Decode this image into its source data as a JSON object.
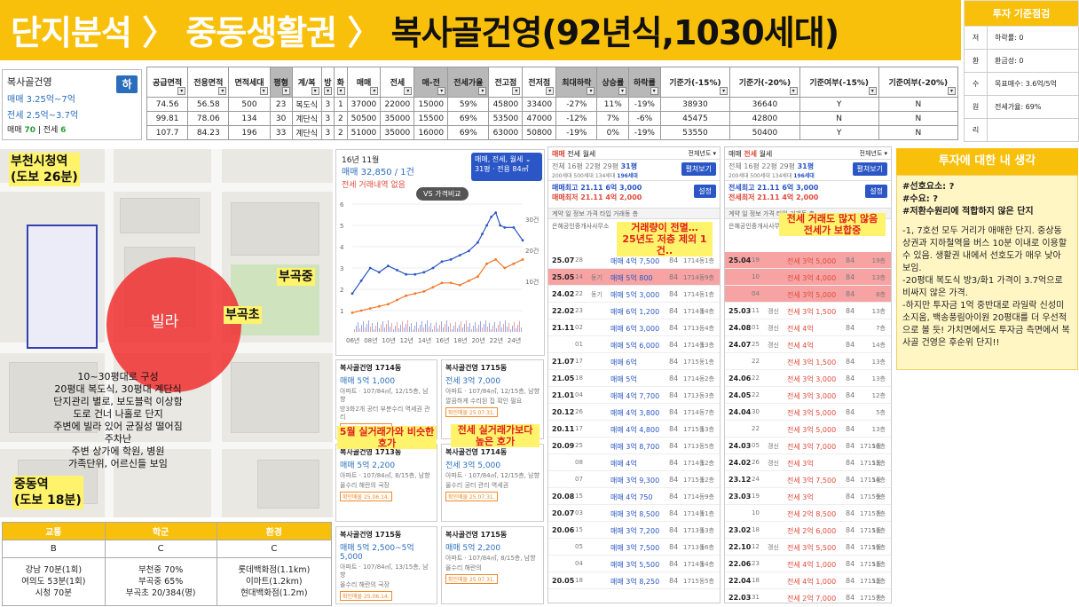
{
  "header": {
    "part1": "단지분석",
    "sep1": "〉",
    "part2": "중동생활권",
    "sep2": "〉",
    "part3": "복사골건영(92년식,1030세대)"
  },
  "criteria": {
    "title": "투자 기준점검",
    "rows": [
      {
        "k": "저",
        "v": "하락률: 0"
      },
      {
        "k": "환",
        "v": "환금성: 0"
      },
      {
        "k": "수",
        "v": "목표매수: 3.6억/5억"
      },
      {
        "k": "원",
        "v": "전세가율: 69%"
      },
      {
        "k": "리",
        "v": ""
      }
    ]
  },
  "complex": {
    "name": "복사골건영",
    "floor_badge": "하",
    "sale_range": "매매 3.25억~7억",
    "jeonse_range": "전세 2.5억~3.7억",
    "sale_label": "매매",
    "sale_count": "70",
    "jeonse_label": "전세",
    "jeonse_count": "6"
  },
  "table": {
    "headers": [
      "공급면적",
      "전용면적",
      "면적세대",
      "평형",
      "계/복",
      "방",
      "화",
      "매매",
      "전세",
      "매-전",
      "전세가율",
      "전고점",
      "전저점",
      "최대하락",
      "상승률",
      "하락률",
      "기준가(-15%)",
      "기준가(-20%)",
      "기준여부(-15%)",
      "기준여부(-20%)"
    ],
    "rows": [
      [
        "74.56",
        "56.58",
        "500",
        "23",
        "복도식",
        "3",
        "1",
        "37000",
        "22000",
        "15000",
        "59%",
        "45800",
        "33400",
        "-27%",
        "11%",
        "-19%",
        "38930",
        "36640",
        "Y",
        "N"
      ],
      [
        "99.81",
        "78.06",
        "134",
        "30",
        "계단식",
        "3",
        "2",
        "50500",
        "35000",
        "15500",
        "69%",
        "53500",
        "47000",
        "-12%",
        "7%",
        "-6%",
        "45475",
        "42800",
        "N",
        "N"
      ],
      [
        "107.7",
        "84.23",
        "196",
        "33",
        "계단식",
        "3",
        "2",
        "51000",
        "35000",
        "16000",
        "69%",
        "63000",
        "50800",
        "-19%",
        "0%",
        "-19%",
        "53550",
        "50400",
        "Y",
        "N"
      ]
    ]
  },
  "map": {
    "station_top": "부천시청역",
    "station_top_walk": "(도보 26분)",
    "school_mid": "부곡중",
    "school_elem": "부곡초",
    "villa": "빌라",
    "station_bottom": "중동역",
    "station_bottom_walk": "(도보 18분)",
    "notes": [
      "10~30평대로 구성",
      "20평대 복도식, 30평대 계단식",
      "단지관리 별로, 보도블럭 이상함",
      "도로 건너 나홀로 단지",
      "주변에 빌라 있어 균질성 떨어짐",
      "주차난",
      "주변 상가에 학원, 병원",
      "가족단위, 어르신들 보임"
    ]
  },
  "scores": {
    "headers": [
      "교통",
      "학군",
      "환경"
    ],
    "grades": [
      "B",
      "C",
      "C"
    ],
    "details": [
      [
        "강남 70분(1회)",
        "여의도 53분(1회)",
        "시청 70분"
      ],
      [
        "부천중 70%",
        "부곡중 65%",
        "부곡초 20/384(명)"
      ],
      [
        "롯데백화점(1.1km)",
        "이마트(1.2km)",
        "현대백화점(1.2m)"
      ]
    ]
  },
  "chart_panel": {
    "date": "16년 11월",
    "price": "매매 32,850 / 1건",
    "no_deal": "전세 거래내역 없음",
    "type_line1": "매매, 전세, 월세 ⌄",
    "type_line2": "31평 · 전용 84㎡",
    "vs": "VS 가격비교",
    "x_ticks": [
      "06년",
      "08년",
      "10년",
      "12년",
      "14년",
      "16년",
      "18년",
      "20년",
      "22년",
      "24년"
    ],
    "y_left": [
      "6",
      "5",
      "4",
      "3",
      "2",
      "1"
    ],
    "y_right": [
      "30건",
      "20건",
      "10건"
    ]
  },
  "chart_data": {
    "type": "line",
    "title": "",
    "xlabel": "",
    "ylabel": "",
    "x_range": [
      2006,
      2025
    ],
    "ylim": [
      0,
      6
    ],
    "series": [
      {
        "name": "매매",
        "color": "#2a56c6",
        "x": [
          2006.0,
          2007.0,
          2008.0,
          2009.0,
          2010.0,
          2011.0,
          2012.0,
          2013.0,
          2014.0,
          2015.0,
          2016.0,
          2017.0,
          2018.0,
          2019.0,
          2020.0,
          2020.5,
          2021.0,
          2021.5,
          2022.0,
          2022.5,
          2023.0,
          2024.0,
          2025.0
        ],
        "y": [
          1.8,
          2.4,
          3.0,
          2.8,
          3.1,
          2.9,
          2.7,
          2.7,
          2.8,
          3.0,
          3.3,
          3.4,
          3.6,
          3.8,
          4.2,
          4.6,
          5.0,
          5.4,
          5.6,
          5.0,
          4.9,
          4.9,
          4.3
        ]
      },
      {
        "name": "전세",
        "color": "#f0792a",
        "x": [
          2006.0,
          2007.0,
          2008.0,
          2009.0,
          2010.0,
          2011.0,
          2012.0,
          2013.0,
          2014.0,
          2015.0,
          2016.0,
          2017.0,
          2018.0,
          2019.0,
          2020.0,
          2021.0,
          2022.0,
          2023.0,
          2024.0,
          2025.0
        ],
        "y": [
          0.9,
          1.0,
          1.1,
          1.2,
          1.3,
          1.5,
          1.7,
          1.8,
          1.9,
          2.1,
          2.3,
          2.3,
          2.2,
          2.4,
          2.6,
          3.2,
          3.4,
          3.0,
          3.2,
          3.4
        ]
      }
    ]
  },
  "listings": [
    {
      "title": "복사골건영 1714동",
      "price": "매매 5억 1,000",
      "d1": "아파트 · 107/84㎡, 12/15층, 남향",
      "d2": "방3화2개 공터 부분수리 역세권 관리",
      "tag": "확인매물 25.06.14."
    },
    {
      "title": "복사골건영 1715동",
      "price": "전세 3억 7,000",
      "d1": "아파트 · 107/84㎡, 12/15층, 남향",
      "d2": "깔끔하게 수리된 집 확인 필요",
      "tag": "확인매물 25.07.31."
    },
    {
      "title": "복사골건영 1713동",
      "price": "매매 5억 2,200",
      "d1": "아파트 · 107/84㎡, 8/15층, 남향",
      "d2": "올수리 해란의 국장",
      "tag": "확인매물 25.06.14."
    },
    {
      "title": "복사골건영 1714동",
      "price": "전세 3억 5,000",
      "d1": "아파트 · 107/84㎡, 12/15층, 남향",
      "d2": "올수리 공터 관리 역세권",
      "tag": "확인매물 25.07.31."
    },
    {
      "title": "복사골건영 1715동",
      "price": "매매 5억 2,500~5억 5,000",
      "d1": "아파트 · 107/84㎡, 13/15층, 남향",
      "d2": "올수리 해란의 국장",
      "tag": "확인매물 25.06.14."
    },
    {
      "title": "복사골건영 1715동",
      "price": "매매 5억 2,200",
      "d1": "아파트 · 107/84㎡, 8/15층, 남향",
      "d2": "올수리 해란의",
      "tag": "확인매물 25.07.31."
    }
  ],
  "notes": {
    "similar": "5월 실거래가와 비슷한 호가",
    "higher_line1": "전세 실거래가보다",
    "higher_line2": "높은 호가",
    "volume_line1": "거래량이 전멸…",
    "volume_line2": "25년도 저층 제외 1건..",
    "jeonse_line1": "전세 거래도 많지 않음",
    "jeonse_line2": "전세가 보합중"
  },
  "tx1": {
    "tab_sale": "매매",
    "tab_jeonse": "전세",
    "tab_rent": "월세",
    "year": "전체년도 ▾",
    "sizes": [
      "전체",
      "16평",
      "22평",
      "29평",
      "31평"
    ],
    "sub": [
      "",
      "200세대",
      "500세대",
      "134세대",
      "196세대"
    ],
    "btn_more": "펼쳐보기",
    "stat1": "매매최고 21.11 6억 3,000",
    "stat2": "매매최저 21.11 4억 2,000",
    "btn_set": "설정",
    "hdr": "계약    일    정보        가격        타입   거래동   층",
    "agent": "은혜공인중개사사무소",
    "rows": [
      {
        "d": "25.07",
        "dd": "28",
        "f": "",
        "p": "매매 4억 7,500",
        "a": "84",
        "u": "1714동",
        "fl": "1층",
        "pink": false
      },
      {
        "d": "25.05",
        "dd": "14",
        "f": "동기",
        "p": "매매 5억 800",
        "a": "84",
        "u": "1714동",
        "fl": "9층",
        "pink": true
      },
      {
        "d": "24.02",
        "dd": "22",
        "f": "동기",
        "p": "매매 5억 3,000",
        "a": "84",
        "u": "1714동",
        "fl": "1층",
        "pink": false
      },
      {
        "d": "22.02",
        "dd": "23",
        "f": "",
        "p": "매매 6억 1,200",
        "a": "84",
        "u": "1714동",
        "fl": "14층",
        "pink": false
      },
      {
        "d": "21.11",
        "dd": "02",
        "f": "",
        "p": "매매 6억 3,000",
        "a": "84",
        "u": "1713동",
        "fl": "4층",
        "pink": false
      },
      {
        "d": "",
        "dd": "01",
        "f": "",
        "p": "매매 5억 6,000",
        "a": "84",
        "u": "1714동",
        "fl": "13층",
        "pink": false
      },
      {
        "d": "21.07",
        "dd": "17",
        "f": "",
        "p": "매매 6억",
        "a": "84",
        "u": "1715동",
        "fl": "1층",
        "pink": false
      },
      {
        "d": "21.05",
        "dd": "18",
        "f": "",
        "p": "매매 5억",
        "a": "84",
        "u": "1714동",
        "fl": "2층",
        "pink": false
      },
      {
        "d": "21.01",
        "dd": "04",
        "f": "",
        "p": "매매 4억 7,700",
        "a": "84",
        "u": "1713동",
        "fl": "3층",
        "pink": false
      },
      {
        "d": "20.12",
        "dd": "26",
        "f": "",
        "p": "매매 4억 3,800",
        "a": "84",
        "u": "1714동",
        "fl": "7층",
        "pink": false
      },
      {
        "d": "20.11",
        "dd": "17",
        "f": "",
        "p": "매매 4억 4,800",
        "a": "84",
        "u": "1715동",
        "fl": "13층",
        "pink": false
      },
      {
        "d": "20.09",
        "dd": "25",
        "f": "",
        "p": "매매 3억 8,700",
        "a": "84",
        "u": "1713동",
        "fl": "5층",
        "pink": false
      },
      {
        "d": "",
        "dd": "08",
        "f": "",
        "p": "매매 4억",
        "a": "84",
        "u": "1714동",
        "fl": "12층",
        "pink": false
      },
      {
        "d": "",
        "dd": "07",
        "f": "",
        "p": "매매 3억 9,300",
        "a": "84",
        "u": "1715동",
        "fl": "12층",
        "pink": false
      },
      {
        "d": "20.08",
        "dd": "15",
        "f": "",
        "p": "매매 4억 750",
        "a": "84",
        "u": "1714동",
        "fl": "9층",
        "pink": false
      },
      {
        "d": "20.07",
        "dd": "03",
        "f": "",
        "p": "매매 3억 8,500",
        "a": "84",
        "u": "1714동",
        "fl": "11층",
        "pink": false
      },
      {
        "d": "20.06",
        "dd": "15",
        "f": "",
        "p": "매매 3억 7,200",
        "a": "84",
        "u": "1713동",
        "fl": "13층",
        "pink": false
      },
      {
        "d": "",
        "dd": "05",
        "f": "",
        "p": "매매 3억 7,500",
        "a": "84",
        "u": "1713동",
        "fl": "16층",
        "pink": false
      },
      {
        "d": "",
        "dd": "04",
        "f": "",
        "p": "매매 3억 5,500",
        "a": "84",
        "u": "1714동",
        "fl": "14층",
        "pink": false
      },
      {
        "d": "20.05",
        "dd": "18",
        "f": "",
        "p": "매매 3억 8,250",
        "a": "84",
        "u": "1715동",
        "fl": "5층",
        "pink": false
      }
    ]
  },
  "tx2": {
    "tab_sale": "매매",
    "tab_jeonse": "전세",
    "tab_rent": "월세",
    "year": "전체년도 ▾",
    "sizes": [
      "전체",
      "16평",
      "22평",
      "29평",
      "31평"
    ],
    "sub": [
      "",
      "200세대",
      "500세대",
      "134세대",
      "196세대"
    ],
    "btn_more": "펼쳐보기",
    "stat1": "전세최고 21.11 6억 3,000",
    "stat2": "전세최저 21.11 4억 2,000",
    "btn_set": "설정",
    "hdr": "계약    일    정보        가격        타입   거래동   층",
    "agent": "은혜공인중개사사무소",
    "rows": [
      {
        "d": "25.04",
        "dd": "19",
        "f": "",
        "p": "전세 3억 5,000",
        "a": "84",
        "u": "",
        "fl": "19층",
        "pink": true
      },
      {
        "d": "",
        "dd": "10",
        "f": "",
        "p": "전세 3억 4,000",
        "a": "84",
        "u": "",
        "fl": "13층",
        "pink": true
      },
      {
        "d": "",
        "dd": "04",
        "f": "",
        "p": "전세 3억 5,000",
        "a": "84",
        "u": "",
        "fl": "8층",
        "pink": true
      },
      {
        "d": "25.03",
        "dd": "11",
        "f": "갱신",
        "p": "전세 3억 1,500",
        "a": "84",
        "u": "",
        "fl": "13층",
        "pink": false
      },
      {
        "d": "24.08",
        "dd": "01",
        "f": "갱신",
        "p": "전세 4억",
        "a": "84",
        "u": "",
        "fl": "7층",
        "pink": false
      },
      {
        "d": "24.07",
        "dd": "25",
        "f": "갱신",
        "p": "전세 4억",
        "a": "84",
        "u": "",
        "fl": "14층",
        "pink": false
      },
      {
        "d": "",
        "dd": "22",
        "f": "",
        "p": "전세 3억 1,500",
        "a": "84",
        "u": "",
        "fl": "13층",
        "pink": false
      },
      {
        "d": "24.06",
        "dd": "22",
        "f": "",
        "p": "전세 3억 3,000",
        "a": "84",
        "u": "",
        "fl": "13층",
        "pink": false
      },
      {
        "d": "24.05",
        "dd": "22",
        "f": "",
        "p": "전세 3억 3,000",
        "a": "84",
        "u": "",
        "fl": "12층",
        "pink": false
      },
      {
        "d": "24.04",
        "dd": "30",
        "f": "",
        "p": "전세 3억 5,000",
        "a": "84",
        "u": "",
        "fl": "5층",
        "pink": false
      },
      {
        "d": "",
        "dd": "22",
        "f": "",
        "p": "전세 3억 5,000",
        "a": "84",
        "u": "",
        "fl": "13층",
        "pink": false
      },
      {
        "d": "24.03",
        "dd": "05",
        "f": "갱신",
        "p": "전세 3억 7,000",
        "a": "84",
        "u": "1715동",
        "fl": "10층",
        "pink": false
      },
      {
        "d": "24.02",
        "dd": "26",
        "f": "갱신",
        "p": "전세 3억",
        "a": "84",
        "u": "1715동",
        "fl": "13층",
        "pink": false
      },
      {
        "d": "23.12",
        "dd": "24",
        "f": "",
        "p": "전세 3억 7,500",
        "a": "84",
        "u": "1715동",
        "fl": "14층",
        "pink": false
      },
      {
        "d": "23.03",
        "dd": "19",
        "f": "",
        "p": "전세 3억",
        "a": "84",
        "u": "1715동",
        "fl": "9층",
        "pink": false
      },
      {
        "d": "",
        "dd": "10",
        "f": "",
        "p": "전세 2억 8,500",
        "a": "84",
        "u": "1715동",
        "fl": "7층",
        "pink": false
      },
      {
        "d": "23.02",
        "dd": "18",
        "f": "",
        "p": "전세 2억 6,000",
        "a": "84",
        "u": "1715동",
        "fl": "13층",
        "pink": false
      },
      {
        "d": "22.10",
        "dd": "12",
        "f": "갱신",
        "p": "전세 3억 5,500",
        "a": "84",
        "u": "1715동",
        "fl": "19층",
        "pink": false
      },
      {
        "d": "22.06",
        "dd": "23",
        "f": "",
        "p": "전세 4억 1,000",
        "a": "84",
        "u": "1715동",
        "fl": "13층",
        "pink": false
      },
      {
        "d": "22.04",
        "dd": "18",
        "f": "",
        "p": "전세 4억 1,000",
        "a": "84",
        "u": "1715동",
        "fl": "12층",
        "pink": false
      },
      {
        "d": "22.03",
        "dd": "31",
        "f": "",
        "p": "전세 2억 7,000",
        "a": "84",
        "u": "1715동",
        "fl": "7층",
        "pink": false
      }
    ]
  },
  "opinion": {
    "title": "투자에 대한 내 생각",
    "tag1": "#선호요소: ?",
    "tag2": "#수요: ?",
    "tag3": "#저환수원리에 적합하지 않은 단지",
    "p1": "-1, 7호선 모두 거리가 애매한 단지. 중상동 상권과 지하철역을 버스 10분 이내로 이용할 수 있음. 생활권 내에서 선호도가 매우 낮아 보임.",
    "p2": "-20평대 복도식 방3/화1 가격이 3.7억으로 비싸지 않은 가격.",
    "p3": "-하지만 투자금 1억 중반대로 라일락 신성미소지움, 백송풍림아이원 20평대를 더 우선적으로 볼 듯! 가치면에서도 투자금 측면에서 복사골 건영은 후순위 단지!!"
  }
}
